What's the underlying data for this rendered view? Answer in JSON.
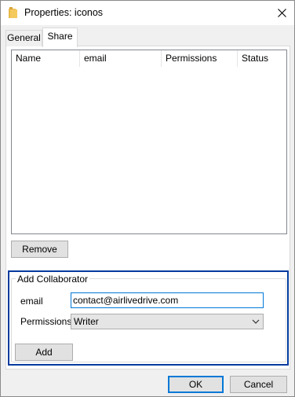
{
  "window": {
    "title": "Properties: iconos",
    "title_icon": "folder-icon",
    "close_icon": "close-icon"
  },
  "tabs": [
    {
      "label": "General",
      "selected": false
    },
    {
      "label": "Share",
      "selected": true
    }
  ],
  "collaborators_list": {
    "columns": [
      "Name",
      "email",
      "Permissions",
      "Status"
    ],
    "rows": []
  },
  "buttons": {
    "remove": "Remove",
    "add": "Add",
    "ok": "OK",
    "cancel": "Cancel"
  },
  "add_collaborator": {
    "group_label": "Add Collaborator",
    "email_label": "email",
    "email_value": "contact@airlivedrive.com",
    "permissions_label": "Permissions",
    "permissions_value": "Writer"
  },
  "colors": {
    "focus_border": "#0078d7",
    "group_highlight": "#003a9e",
    "button_face": "#e1e1e1"
  }
}
